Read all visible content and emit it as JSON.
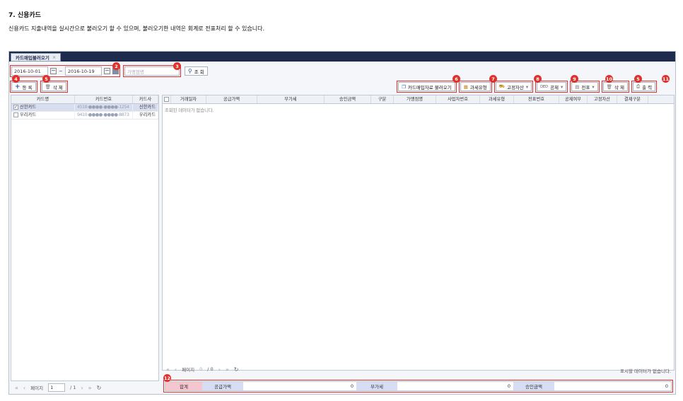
{
  "doc": {
    "title": "7. 신용카드",
    "desc": "신용카드 지출내역을 실시간으로 불러오기 할 수 있으며, 불러오기한 내역은 회계로 전표처리 할 수 있습니다."
  },
  "app": {
    "tab_label": "카드매입불러오기",
    "tab_close": "×",
    "date_from": "2016-10-01",
    "date_sep": "~",
    "date_to": "2016-10-19",
    "vendor_placeholder": "가맹점명",
    "search_label": "조 회",
    "add_label": "등 록",
    "delete_label": "삭 제"
  },
  "toolbar": {
    "import_label": "카드매입자료 불러오기",
    "tax_label": "과세유형",
    "asset_label": "고정자산",
    "deduct_label": "공제",
    "voucher_label": "전표",
    "delete_label": "삭 제",
    "print_label": "출 력"
  },
  "badges": [
    "2",
    "3",
    "4",
    "5",
    "6",
    "7",
    "8",
    "9",
    "10",
    "5",
    "11",
    "12"
  ],
  "card_grid": {
    "headers": [
      "카드명",
      "카드번호",
      "카드사"
    ],
    "rows": [
      {
        "name": "신한카드",
        "number": "4518-●●●●-●●●●-1254",
        "company": "신한카드",
        "checked": "✓"
      },
      {
        "name": "우리카드",
        "number": "9410-●●●●-●●●●-8873",
        "company": "우리카드",
        "checked": ""
      }
    ]
  },
  "main_grid": {
    "headers": [
      "거래일자",
      "공급가액",
      "부가세",
      "승인금액",
      "구분",
      "가맹점명",
      "사업자번호",
      "과세유형",
      "전표번호",
      "공제여부",
      "고정자산",
      "결제구분"
    ],
    "empty_message": "조회된 데이터가 없습니다."
  },
  "pager_left": {
    "label": "페이지",
    "page": "1",
    "total": "/ 1"
  },
  "pager_right": {
    "label": "페이지",
    "page": "0",
    "total": "/ 0",
    "empty": "표시할 데이터가 없습니다."
  },
  "summary": {
    "total_label": "합계",
    "supply_label": "공급가액",
    "supply_value": "0",
    "vat_label": "부가세",
    "vat_value": "0",
    "approve_label": "승인금액",
    "approve_value": "0"
  },
  "colors": {
    "badge": "#e0322c",
    "tabbar": "#1e2b4d",
    "selected_row": "#d8def0",
    "sum_total_bg": "#f6c6cf",
    "sum_label_bg": "#d7ddf2"
  }
}
